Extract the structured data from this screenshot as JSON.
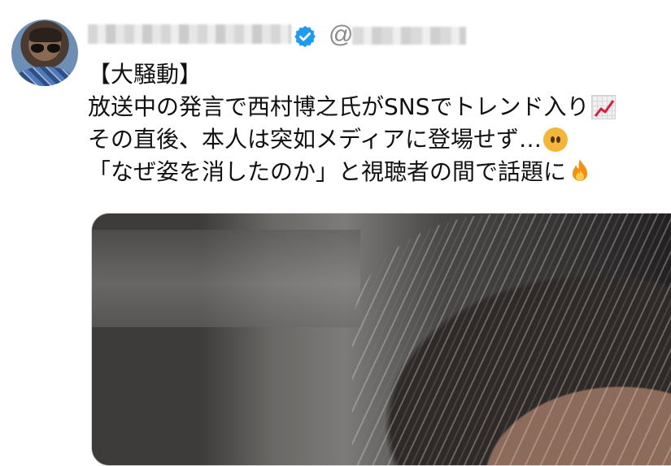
{
  "author": {
    "verified_icon": "verified-badge-icon",
    "handle_prefix": "@",
    "avatar_icon": "profile-avatar"
  },
  "tweet": {
    "lines": [
      "【大騒動】",
      "放送中の発言で西村博之氏がSNSでトレンド入り",
      "その直後、本人は突如メディアに登場せず…",
      "「なぜ姿を消したのか」と視聴者の間で話題に"
    ],
    "emojis": [
      "chart-increasing-icon",
      "no-mouth-face-icon",
      "fire-icon"
    ]
  },
  "colors": {
    "verified_blue": "#1d9bf0",
    "text": "#111111",
    "handle_gray": "#8a8a8a"
  }
}
